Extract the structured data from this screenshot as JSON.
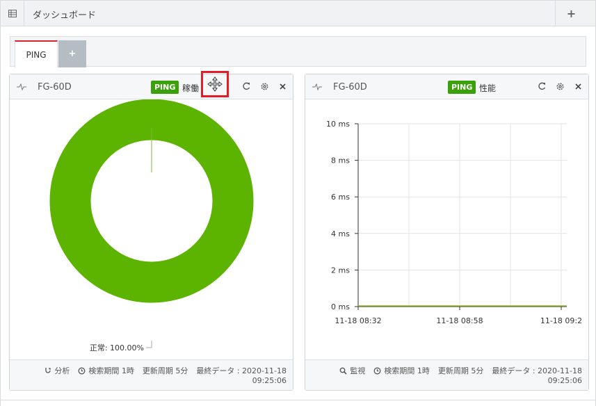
{
  "header": {
    "title": "ダッシュボード",
    "add_label": "+"
  },
  "tabs": {
    "active_label": "PING",
    "add_label": "+"
  },
  "widget_left": {
    "device": "FG-60D",
    "badge": "PING",
    "title": "稼働",
    "footer": {
      "analysis": "分析",
      "period": "検索期間 1時",
      "interval": "更新周期 5分",
      "last_data": "最終データ : 2020-11-18",
      "last_time": "09:25:06"
    }
  },
  "widget_right": {
    "device": "FG-60D",
    "badge": "PING",
    "title": "性能",
    "footer": {
      "monitor": "監視",
      "period": "検索期間 1時",
      "interval": "更新周期 5分",
      "last_data": "最終データ : 2020-11-18",
      "last_time": "09:25:06"
    }
  },
  "colors": {
    "accent_red": "#d9232e",
    "ping_green": "#3aa10a",
    "donut_green": "#5cb400",
    "highlight": "#e21d26"
  },
  "chart_data": [
    {
      "type": "pie",
      "categories": [
        "正常"
      ],
      "values": [
        100.0
      ],
      "slice_label": "正常: 100.00%",
      "donut": true,
      "title": ""
    },
    {
      "type": "line",
      "x": [
        "11-18 08:32",
        "11-18 08:58",
        "11-18 09:2"
      ],
      "series": [
        {
          "values": [
            0,
            0,
            0
          ]
        }
      ],
      "y_ticks": [
        "0 ms",
        "2 ms",
        "4 ms",
        "6 ms",
        "8 ms",
        "10 ms"
      ],
      "ylim": [
        0,
        10
      ],
      "grid": true,
      "title": ""
    }
  ]
}
